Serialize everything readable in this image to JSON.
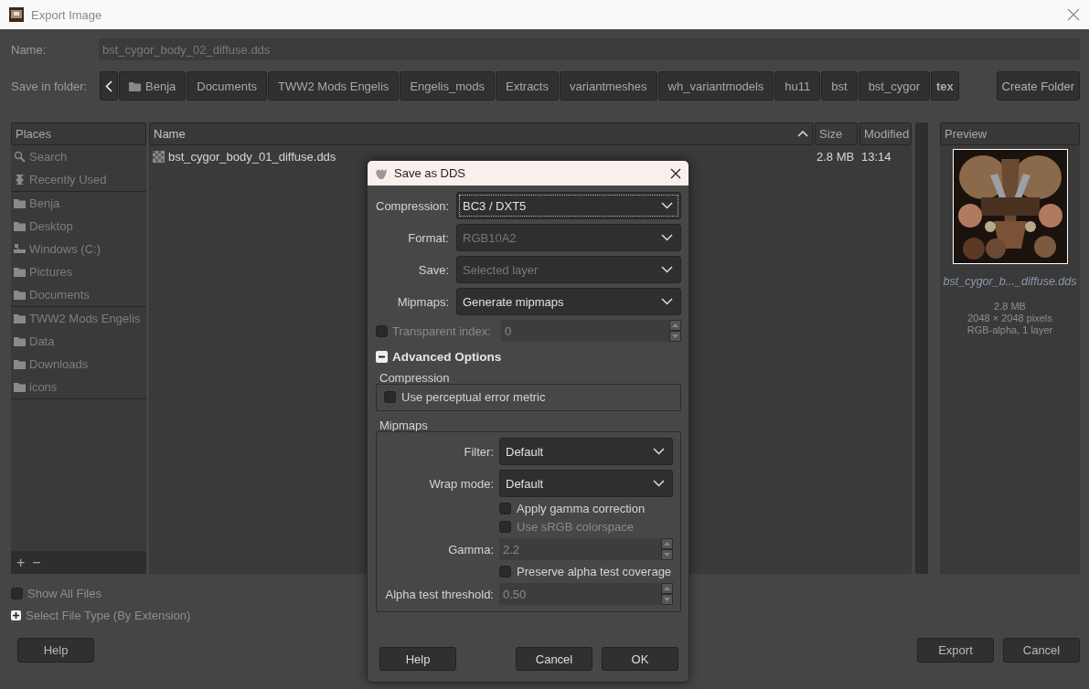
{
  "window": {
    "title": "Export Image"
  },
  "name_field": {
    "label": "Name:",
    "value": "bst_cygor_body_02_diffuse.dds"
  },
  "folder_bar": {
    "label": "Save in folder:",
    "segments": [
      {
        "label": "Benja",
        "kind": "folder",
        "selected": false
      },
      {
        "label": "Documents",
        "kind": "plain",
        "selected": false
      },
      {
        "label": "TWW2 Mods Engelis",
        "kind": "plain",
        "selected": false
      },
      {
        "label": "Engelis_mods",
        "kind": "plain",
        "selected": false
      },
      {
        "label": "Extracts",
        "kind": "plain",
        "selected": false
      },
      {
        "label": "variantmeshes",
        "kind": "plain",
        "selected": false
      },
      {
        "label": "wh_variantmodels",
        "kind": "plain",
        "selected": false
      },
      {
        "label": "hu11",
        "kind": "plain",
        "selected": false
      },
      {
        "label": "bst",
        "kind": "plain",
        "selected": false
      },
      {
        "label": "bst_cygor",
        "kind": "plain",
        "selected": false
      },
      {
        "label": "tex",
        "kind": "plain",
        "selected": true
      }
    ],
    "create_button": "Create Folder"
  },
  "places": {
    "title": "Places",
    "groups": [
      [
        {
          "label": "Search",
          "kind": "search"
        },
        {
          "label": "Recently Used",
          "kind": "recent"
        }
      ],
      [
        {
          "label": "Benja",
          "kind": "folder"
        },
        {
          "label": "Desktop",
          "kind": "folder"
        },
        {
          "label": "Windows (C:)",
          "kind": "drive"
        },
        {
          "label": "Pictures",
          "kind": "folder"
        },
        {
          "label": "Documents",
          "kind": "folder"
        }
      ],
      [
        {
          "label": "TWW2 Mods Engelis",
          "kind": "folder"
        },
        {
          "label": "Data",
          "kind": "folder"
        },
        {
          "label": "Downloads",
          "kind": "folder"
        },
        {
          "label": "icons",
          "kind": "folder"
        }
      ]
    ],
    "add_button": "+",
    "remove_button": "−"
  },
  "file_list": {
    "columns": [
      {
        "label": "Name",
        "sorted": true
      },
      {
        "label": "Size",
        "sorted": false
      },
      {
        "label": "Modified",
        "sorted": false
      }
    ],
    "rows": [
      {
        "cells": [
          "bst_cygor_body_01_diffuse.dds",
          "2.8 MB",
          "13:14"
        ]
      }
    ]
  },
  "preview": {
    "title": "Preview",
    "filename": "bst_cygor_b..._diffuse.dds",
    "info": [
      "2.8 MB",
      "2048 × 2048 pixels",
      "RGB-alpha, 1 layer"
    ]
  },
  "show_all_files": {
    "label": "Show All Files",
    "checked": false
  },
  "file_type_expander": {
    "label": "Select File Type (By Extension)",
    "expanded": false
  },
  "buttons": {
    "left": [
      "Help"
    ],
    "right": [
      "Export",
      "Cancel"
    ]
  },
  "dds_dialog": {
    "title": "Save as DDS",
    "fields": [
      {
        "kind": "dropdown",
        "label": "Compression:",
        "value": "BC3 / DXT5",
        "disabled": false,
        "focused": true
      },
      {
        "kind": "dropdown",
        "label": "Format:",
        "value": "RGB10A2",
        "disabled": true,
        "focused": false
      },
      {
        "kind": "dropdown",
        "label": "Save:",
        "value": "Selected layer",
        "disabled": true,
        "focused": false
      },
      {
        "kind": "dropdown",
        "label": "Mipmaps:",
        "value": "Generate mipmaps",
        "disabled": false,
        "focused": false
      },
      {
        "kind": "checkspin",
        "label": "Transparent index:",
        "checked": false,
        "value": "0",
        "disabled": true
      }
    ],
    "advanced": {
      "label": "Advanced Options",
      "expanded": true
    },
    "frames": [
      {
        "title": "Compression",
        "fields": [
          {
            "kind": "check",
            "label": "Use perceptual error metric",
            "checked": false,
            "disabled": false
          }
        ]
      },
      {
        "title": "Mipmaps",
        "fields": [
          {
            "kind": "dropdown",
            "label": "Filter:",
            "value": "Default",
            "disabled": false,
            "focused": false
          },
          {
            "kind": "dropdown",
            "label": "Wrap mode:",
            "value": "Default",
            "disabled": false,
            "focused": false
          },
          {
            "kind": "check",
            "label": "Apply gamma correction",
            "checked": false,
            "disabled": false
          },
          {
            "kind": "check",
            "label": "Use sRGB colorspace",
            "checked": false,
            "disabled": true
          },
          {
            "kind": "spin",
            "label": "Gamma:",
            "value": "2.2",
            "disabled": true
          },
          {
            "kind": "check",
            "label": "Preserve alpha test coverage",
            "checked": false,
            "disabled": false
          },
          {
            "kind": "spin",
            "label": "Alpha test threshold:",
            "value": "0.50",
            "disabled": true
          }
        ]
      }
    ],
    "buttons": {
      "left": [
        "Help"
      ],
      "right": [
        "Cancel",
        "OK"
      ]
    }
  }
}
